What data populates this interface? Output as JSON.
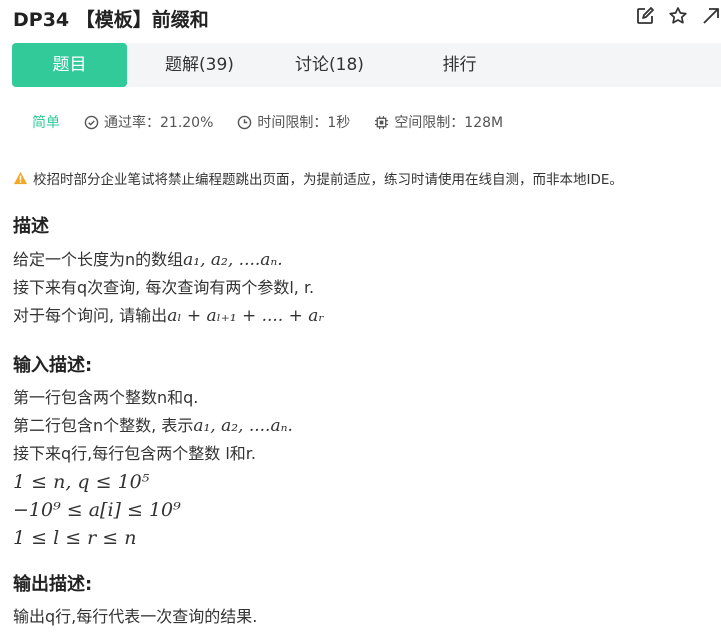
{
  "problem": {
    "title": "DP34 【模板】前缀和"
  },
  "tabs": [
    {
      "label": "题目",
      "active": true
    },
    {
      "label": "题解(39)",
      "active": false
    },
    {
      "label": "讨论(18)",
      "active": false
    },
    {
      "label": "排行",
      "active": false
    }
  ],
  "meta": {
    "level": "简单",
    "pass_rate": "通过率：21.20%",
    "time_limit": "时间限制：1秒",
    "memory_limit": "空间限制：128M"
  },
  "notice": "校招时部分企业笔试将禁止编程题跳出页面，为提前适应，练习时请使用在线自测，而非本地IDE。",
  "description": {
    "heading": "描述",
    "line1_text": "给定一个长度为n的数组",
    "line1_math": "a₁, a₂, ....aₙ.",
    "line2": "接下来有q次查询, 每次查询有两个参数l, r.",
    "line3_text": "对于每个询问, 请输出",
    "line3_math": "aₗ + aₗ₊₁ + .... + aᵣ"
  },
  "input": {
    "heading": "输入描述:",
    "line1": "第一行包含两个整数n和q.",
    "line2_text": "第二行包含n个整数, 表示",
    "line2_math": "a₁, a₂, ....aₙ.",
    "line3": "接下来q行,每行包含两个整数   l和r.",
    "c1": "1 ≤ n, q ≤ 10⁵",
    "c2": "−10⁹ ≤ a[i] ≤ 10⁹",
    "c3": "1 ≤ l ≤ r ≤ n"
  },
  "output": {
    "heading": "输出描述:",
    "line1": "输出q行,每行代表一次查询的结果."
  },
  "colors": {
    "accent": "#32ca99",
    "warning": "#f5a623",
    "tab_bg": "#f4f5f6"
  }
}
